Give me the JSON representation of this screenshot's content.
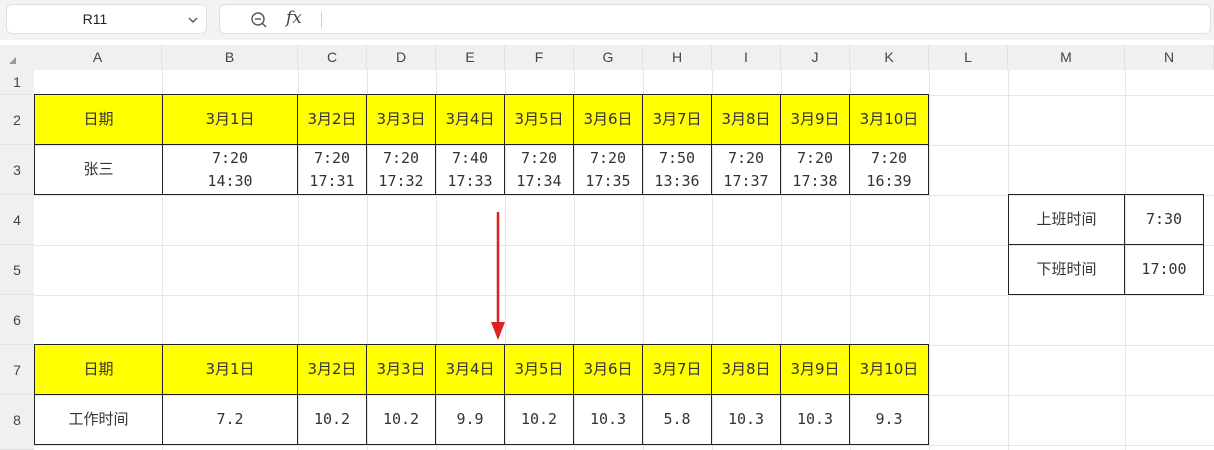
{
  "name_box": {
    "value": "R11"
  },
  "formula_bar": {
    "content": ""
  },
  "columns": [
    "A",
    "B",
    "C",
    "D",
    "E",
    "F",
    "G",
    "H",
    "I",
    "J",
    "K",
    "L",
    "M",
    "N"
  ],
  "rows": [
    "1",
    "2",
    "3",
    "4",
    "5",
    "6",
    "7",
    "8"
  ],
  "table1": {
    "header_label": "日期",
    "dates": [
      "3月1日",
      "3月2日",
      "3月3日",
      "3月4日",
      "3月5日",
      "3月6日",
      "3月7日",
      "3月8日",
      "3月9日",
      "3月10日"
    ],
    "name": "张三",
    "times": [
      {
        "in": "7:20",
        "out": "14:30"
      },
      {
        "in": "7:20",
        "out": "17:31"
      },
      {
        "in": "7:20",
        "out": "17:32"
      },
      {
        "in": "7:40",
        "out": "17:33"
      },
      {
        "in": "7:20",
        "out": "17:34"
      },
      {
        "in": "7:20",
        "out": "17:35"
      },
      {
        "in": "7:50",
        "out": "13:36"
      },
      {
        "in": "7:20",
        "out": "17:37"
      },
      {
        "in": "7:20",
        "out": "17:38"
      },
      {
        "in": "7:20",
        "out": "16:39"
      }
    ]
  },
  "side_table": {
    "start_label": "上班时间",
    "start_value": "7:30",
    "end_label": "下班时间",
    "end_value": "17:00"
  },
  "table2": {
    "header_label": "日期",
    "dates": [
      "3月1日",
      "3月2日",
      "3月3日",
      "3月4日",
      "3月5日",
      "3月6日",
      "3月7日",
      "3月8日",
      "3月9日",
      "3月10日"
    ],
    "row_label": "工作时间",
    "values": [
      "7.2",
      "10.2",
      "10.2",
      "9.9",
      "10.2",
      "10.3",
      "5.8",
      "10.3",
      "10.3",
      "9.3"
    ]
  },
  "colors": {
    "header_fill": "#ffff00",
    "arrow": "#e02020"
  }
}
